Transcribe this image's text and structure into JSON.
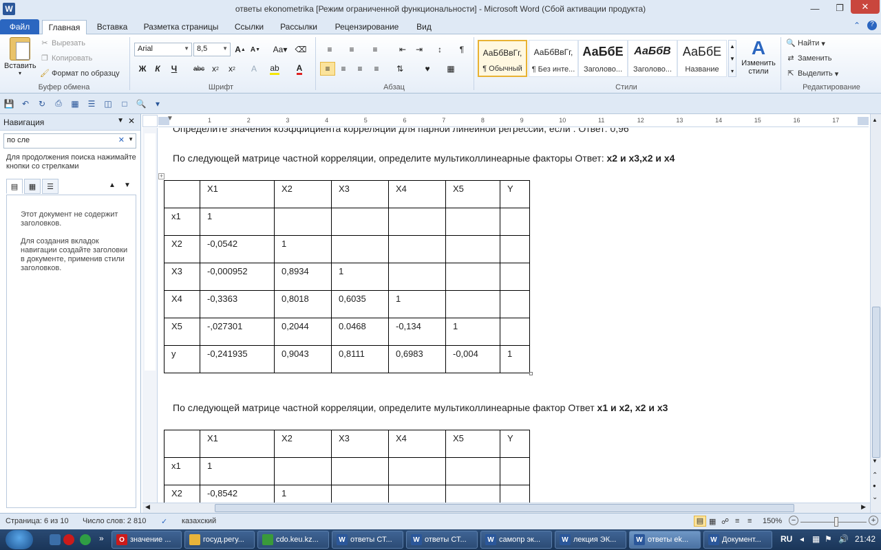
{
  "window": {
    "title": "ответы ekonometrika [Режим ограниченной функциональности]  -  Microsoft Word (Сбой активации продукта)"
  },
  "tabs": [
    "Файл",
    "Главная",
    "Вставка",
    "Разметка страницы",
    "Ссылки",
    "Рассылки",
    "Рецензирование",
    "Вид"
  ],
  "clipboard": {
    "paste": "Вставить",
    "cut": "Вырезать",
    "copy": "Копировать",
    "format_painter": "Формат по образцу",
    "label": "Буфер обмена"
  },
  "font": {
    "name": "Arial",
    "size": "8,5",
    "label": "Шрифт",
    "bold": "Ж",
    "italic": "К",
    "underline": "Ч",
    "strike": "abc"
  },
  "paragraph": {
    "label": "Абзац"
  },
  "styles": {
    "label": "Стили",
    "items": [
      {
        "sample": "АаБбВвГг,",
        "name": "¶ Обычный"
      },
      {
        "sample": "АаБбВвГг,",
        "name": "¶ Без инте..."
      },
      {
        "sample": "АаБбЕ",
        "name": "Заголово..."
      },
      {
        "sample": "АаБбВ",
        "name": "Заголово..."
      },
      {
        "sample": "АаБбЕ",
        "name": "Название"
      }
    ],
    "change": "Изменить стили"
  },
  "editing": {
    "find": "Найти",
    "replace": "Заменить",
    "select": "Выделить",
    "label": "Редактирование"
  },
  "nav": {
    "title": "Навигация",
    "search_value": "по сле",
    "hint": "Для продолжения поиска нажимайте кнопки со стрелками",
    "msg1": "Этот документ не содержит заголовков.",
    "msg2": "Для создания вкладок навигации создайте заголовки в документе, применив стили заголовков."
  },
  "ruler_numbers": [
    "1",
    "2",
    "3",
    "4",
    "5",
    "6",
    "7",
    "8",
    "9",
    "10",
    "11",
    "12",
    "13",
    "14",
    "15",
    "16",
    "17"
  ],
  "doc": {
    "cut_line": "Определите значения коэффициента корреляции для парной линейной регрессии, если . Ответ: 0,96",
    "q1_text": "По следующей матрице частной корреляции, определите мультиколлинеарные факторы   Ответ: ",
    "q1_answer": "x2 и x3,x2 и x4",
    "table1": [
      [
        "",
        "X1",
        "X2",
        "X3",
        "X4",
        "X5",
        "Y"
      ],
      [
        "x1",
        "1",
        "",
        "",
        "",
        "",
        ""
      ],
      [
        "X2",
        "-0,0542",
        "1",
        "",
        "",
        "",
        ""
      ],
      [
        "X3",
        "-0,000952",
        "0,8934",
        "1",
        "",
        "",
        ""
      ],
      [
        "X4",
        "-0,3363",
        "0,8018",
        "0,6035",
        "1",
        "",
        ""
      ],
      [
        "X5",
        "-,027301",
        "0,2044",
        "0.0468",
        "-0,134",
        "1",
        ""
      ],
      [
        "y",
        "-0,241935",
        "0,9043",
        "0,8111",
        "0,6983",
        "-0,004",
        "1"
      ]
    ],
    "q2_text": "По следующей матрице частной корреляции, определите мультиколлинеарные фактор      Ответ ",
    "q2_answer": "x1 и x2, x2 и x3",
    "table2": [
      [
        "",
        "X1",
        "X2",
        "X3",
        "X4",
        "X5",
        "Y"
      ],
      [
        "x1",
        "1",
        "",
        "",
        "",
        "",
        ""
      ],
      [
        "X2",
        "-0,8542",
        "1",
        "",
        "",
        "",
        ""
      ]
    ]
  },
  "status": {
    "page": "Страница: 6 из 10",
    "words": "Число слов: 2 810",
    "lang": "казахский",
    "zoom": "150%"
  },
  "taskbar": {
    "items": [
      {
        "label": "значение ...",
        "color": "#cc1b1b",
        "glyph": "O"
      },
      {
        "label": "госуд.регу...",
        "color": "#e8b43a",
        "glyph": ""
      },
      {
        "label": "cdo.keu.kz...",
        "color": "#3a9a3a",
        "glyph": ""
      },
      {
        "label": "ответы СТ...",
        "color": "#2b579a",
        "glyph": "W"
      },
      {
        "label": "ответы СТ...",
        "color": "#2b579a",
        "glyph": "W"
      },
      {
        "label": "самопр эк...",
        "color": "#2b579a",
        "glyph": "W"
      },
      {
        "label": "лекция ЭК...",
        "color": "#2b579a",
        "glyph": "W"
      },
      {
        "label": "ответы ek...",
        "color": "#2b579a",
        "glyph": "W"
      },
      {
        "label": "Документ...",
        "color": "#2b579a",
        "glyph": "W"
      }
    ],
    "lang": "RU",
    "time": "21:42"
  }
}
